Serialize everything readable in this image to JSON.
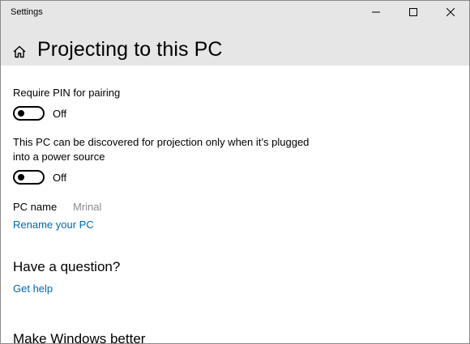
{
  "window": {
    "app_title": "Settings",
    "buttons": {
      "minimize": "minimize-icon",
      "maximize": "maximize-icon",
      "close": "close-icon"
    }
  },
  "header": {
    "home_icon": "home-icon",
    "title": "Projecting to this PC"
  },
  "settings": {
    "require_pin": {
      "label": "Require PIN for pairing",
      "state": "Off"
    },
    "power_source": {
      "label_line1": "This PC can be discovered for projection only when it’s plugged",
      "label_line2": "into a power source",
      "state": "Off"
    },
    "pc_name": {
      "label": "PC name",
      "value": "Mrinal"
    },
    "rename_link": "Rename your PC"
  },
  "help": {
    "heading": "Have a question?",
    "link": "Get help"
  },
  "feedback": {
    "heading": "Make Windows better"
  },
  "colors": {
    "titlebar": "#e6e6e6",
    "link": "#0067b8",
    "muted": "#8a8a8a"
  }
}
